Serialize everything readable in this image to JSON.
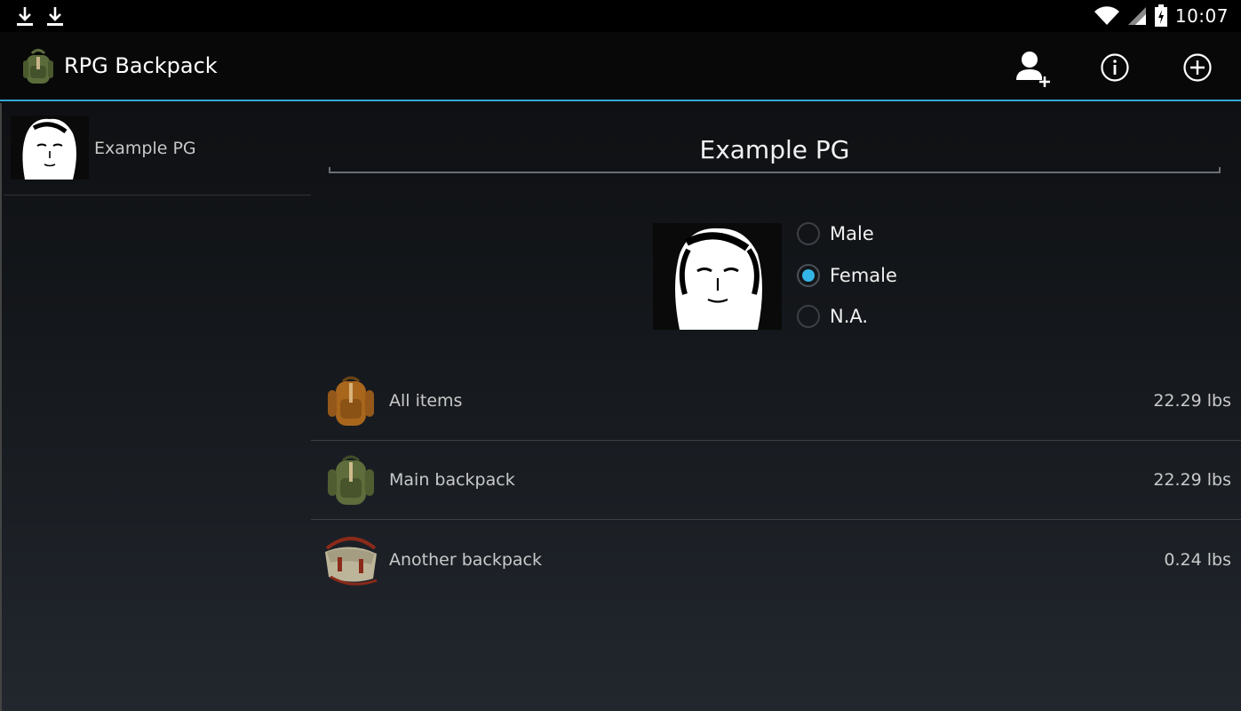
{
  "status_bar": {
    "time": "10:07",
    "left_icons": [
      "download-icon",
      "download-icon"
    ],
    "right_icons": [
      "wifi-icon",
      "signal-icon",
      "battery-icon"
    ]
  },
  "action_bar": {
    "title": "RPG Backpack",
    "logo_icon": "backpack-icon",
    "actions": [
      "add-character-icon",
      "info-icon",
      "add-circle-icon"
    ],
    "accent_color": "#33a8d6"
  },
  "characters": [
    {
      "name": "Example PG",
      "avatar_icon": "portrait-icon"
    }
  ],
  "detail": {
    "title": "Example PG",
    "gender_options": [
      {
        "label": "Male",
        "checked": false
      },
      {
        "label": "Female",
        "checked": true
      },
      {
        "label": "N.A.",
        "checked": false
      }
    ],
    "radio_accent": "#33b5e5"
  },
  "backpacks": [
    {
      "label": "All items",
      "weight": "22.29 lbs",
      "icon": "brown-backpack-icon"
    },
    {
      "label": "Main backpack",
      "weight": "22.29 lbs",
      "icon": "green-backpack-icon"
    },
    {
      "label": "Another backpack",
      "weight": "0.24 lbs",
      "icon": "satchel-icon"
    }
  ]
}
